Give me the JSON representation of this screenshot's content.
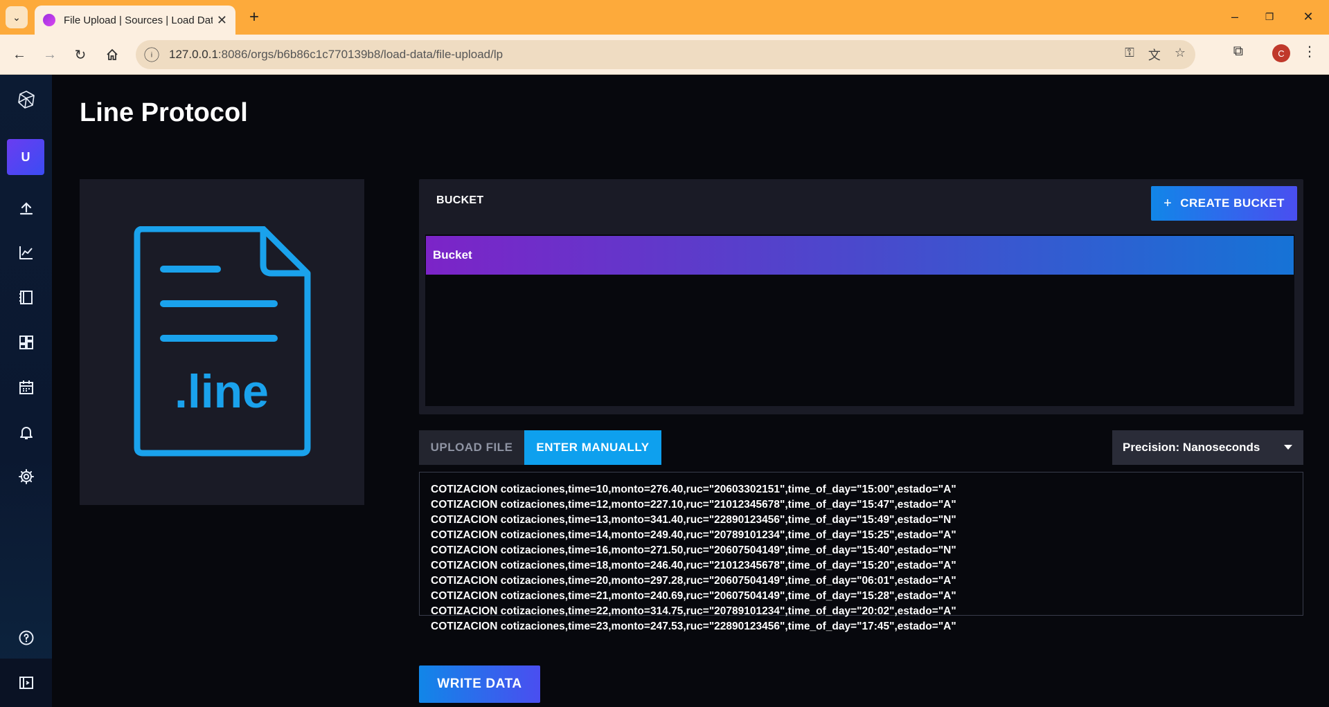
{
  "browser": {
    "tab_title": "File Upload | Sources | Load Dat",
    "url_host": "127.0.0.1",
    "url_path": ":8086/orgs/b6b86c1c770139b8/load-data/file-upload/lp",
    "profile_initial": "C"
  },
  "sidebar": {
    "user_initial": "U",
    "items": [
      "upload-icon",
      "chart-icon",
      "notebook-icon",
      "dashboard-icon",
      "calendar-icon",
      "bell-icon",
      "gear-icon",
      "help-icon",
      "collapse-icon"
    ]
  },
  "page": {
    "title": "Line Protocol",
    "file_type_label": ".line"
  },
  "bucket": {
    "header": "BUCKET",
    "create_label": "CREATE BUCKET",
    "items": [
      "Bucket"
    ]
  },
  "tabs": {
    "upload": "UPLOAD FILE",
    "manual": "ENTER MANUALLY"
  },
  "precision": {
    "label": "Precision: Nanoseconds"
  },
  "line_protocol": [
    "COTIZACION cotizaciones,time=10,monto=276.40,ruc=\"20603302151\",time_of_day=\"15:00\",estado=\"A\"",
    "COTIZACION cotizaciones,time=12,monto=227.10,ruc=\"21012345678\",time_of_day=\"15:47\",estado=\"A\"",
    "COTIZACION cotizaciones,time=13,monto=341.40,ruc=\"22890123456\",time_of_day=\"15:49\",estado=\"N\"",
    "COTIZACION cotizaciones,time=14,monto=249.40,ruc=\"20789101234\",time_of_day=\"15:25\",estado=\"A\"",
    "COTIZACION cotizaciones,time=16,monto=271.50,ruc=\"20607504149\",time_of_day=\"15:40\",estado=\"N\"",
    "COTIZACION cotizaciones,time=18,monto=246.40,ruc=\"21012345678\",time_of_day=\"15:20\",estado=\"A\"",
    "COTIZACION cotizaciones,time=20,monto=297.28,ruc=\"20607504149\",time_of_day=\"06:01\",estado=\"A\"",
    "COTIZACION cotizaciones,time=21,monto=240.69,ruc=\"20607504149\",time_of_day=\"15:28\",estado=\"A\"",
    "COTIZACION cotizaciones,time=22,monto=314.75,ruc=\"20789101234\",time_of_day=\"20:02\",estado=\"A\"",
    "COTIZACION cotizaciones,time=23,monto=247.53,ruc=\"22890123456\",time_of_day=\"17:45\",estado=\"A\""
  ],
  "actions": {
    "write_label": "WRITE DATA"
  },
  "colors": {
    "accent_blue": "#0ea0ee",
    "bucket_gradient_start": "#7c24c8",
    "bucket_gradient_end": "#1673d6",
    "browser_frame": "#fdaa3b"
  }
}
